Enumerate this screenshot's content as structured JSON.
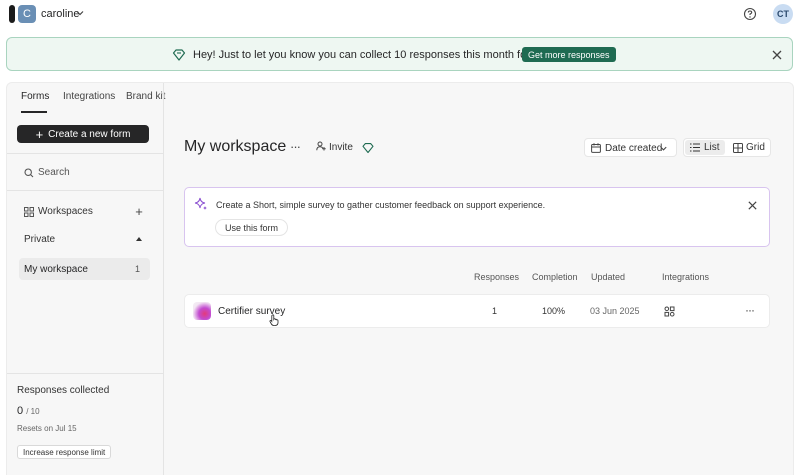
{
  "account": {
    "avatar_letter": "C",
    "name": "caroline",
    "user_initials": "CT"
  },
  "banner": {
    "text": "Hey! Just to let you know you can collect 10 responses this month for free.",
    "cta": "Get more responses"
  },
  "tabs": [
    {
      "label": "Forms",
      "active": true
    },
    {
      "label": "Integrations",
      "active": false
    },
    {
      "label": "Brand kit",
      "active": false
    }
  ],
  "sidebar": {
    "create_label": "Create a new form",
    "search_label": "Search",
    "workspaces_label": "Workspaces",
    "private_label": "Private",
    "workspace_item": {
      "label": "My workspace",
      "count": "1"
    },
    "responses": {
      "label": "Responses collected",
      "collected": "0",
      "limit": "/ 10",
      "resets": "Resets on Jul 15",
      "increase_label": "Increase response limit"
    }
  },
  "workspace": {
    "title": "My workspace",
    "more": "···",
    "invite": "Invite",
    "sort_label": "Date created",
    "view_list": "List",
    "view_grid": "Grid"
  },
  "suggestion": {
    "text": "Create a Short, simple survey to gather customer feedback on support experience.",
    "use_label": "Use this form"
  },
  "table": {
    "columns": [
      "Responses",
      "Completion",
      "Updated",
      "Integrations"
    ],
    "rows": [
      {
        "name": "Certifier survey",
        "responses": "1",
        "completion": "100%",
        "updated": "03 Jun 2025",
        "more": "···"
      }
    ]
  },
  "colors": {
    "brand_dark": "#262627",
    "banner_bg": "#eef7f2",
    "banner_cta": "#1f6b52",
    "suggest_border": "#d8c4ef"
  }
}
